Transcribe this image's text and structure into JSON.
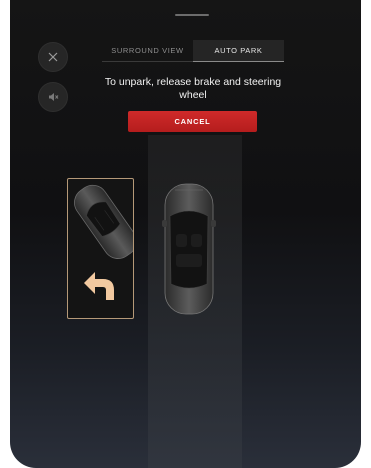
{
  "header": {
    "tabs": [
      {
        "label": "SURROUND VIEW",
        "active": false
      },
      {
        "label": "AUTO PARK",
        "active": true
      }
    ]
  },
  "controls": {
    "close_icon": "close-icon",
    "mute_icon": "speaker-mute-icon"
  },
  "instruction": "To unpark, release brake and steering wheel",
  "cancel_label": "CANCEL",
  "colors": {
    "cancel_button": "#c82424",
    "spot_outline": "#b59978",
    "arrow": "#f2c9a0"
  },
  "icons": {
    "direction": "curved-arrow-left-icon",
    "car": "car-top-view-icon"
  }
}
